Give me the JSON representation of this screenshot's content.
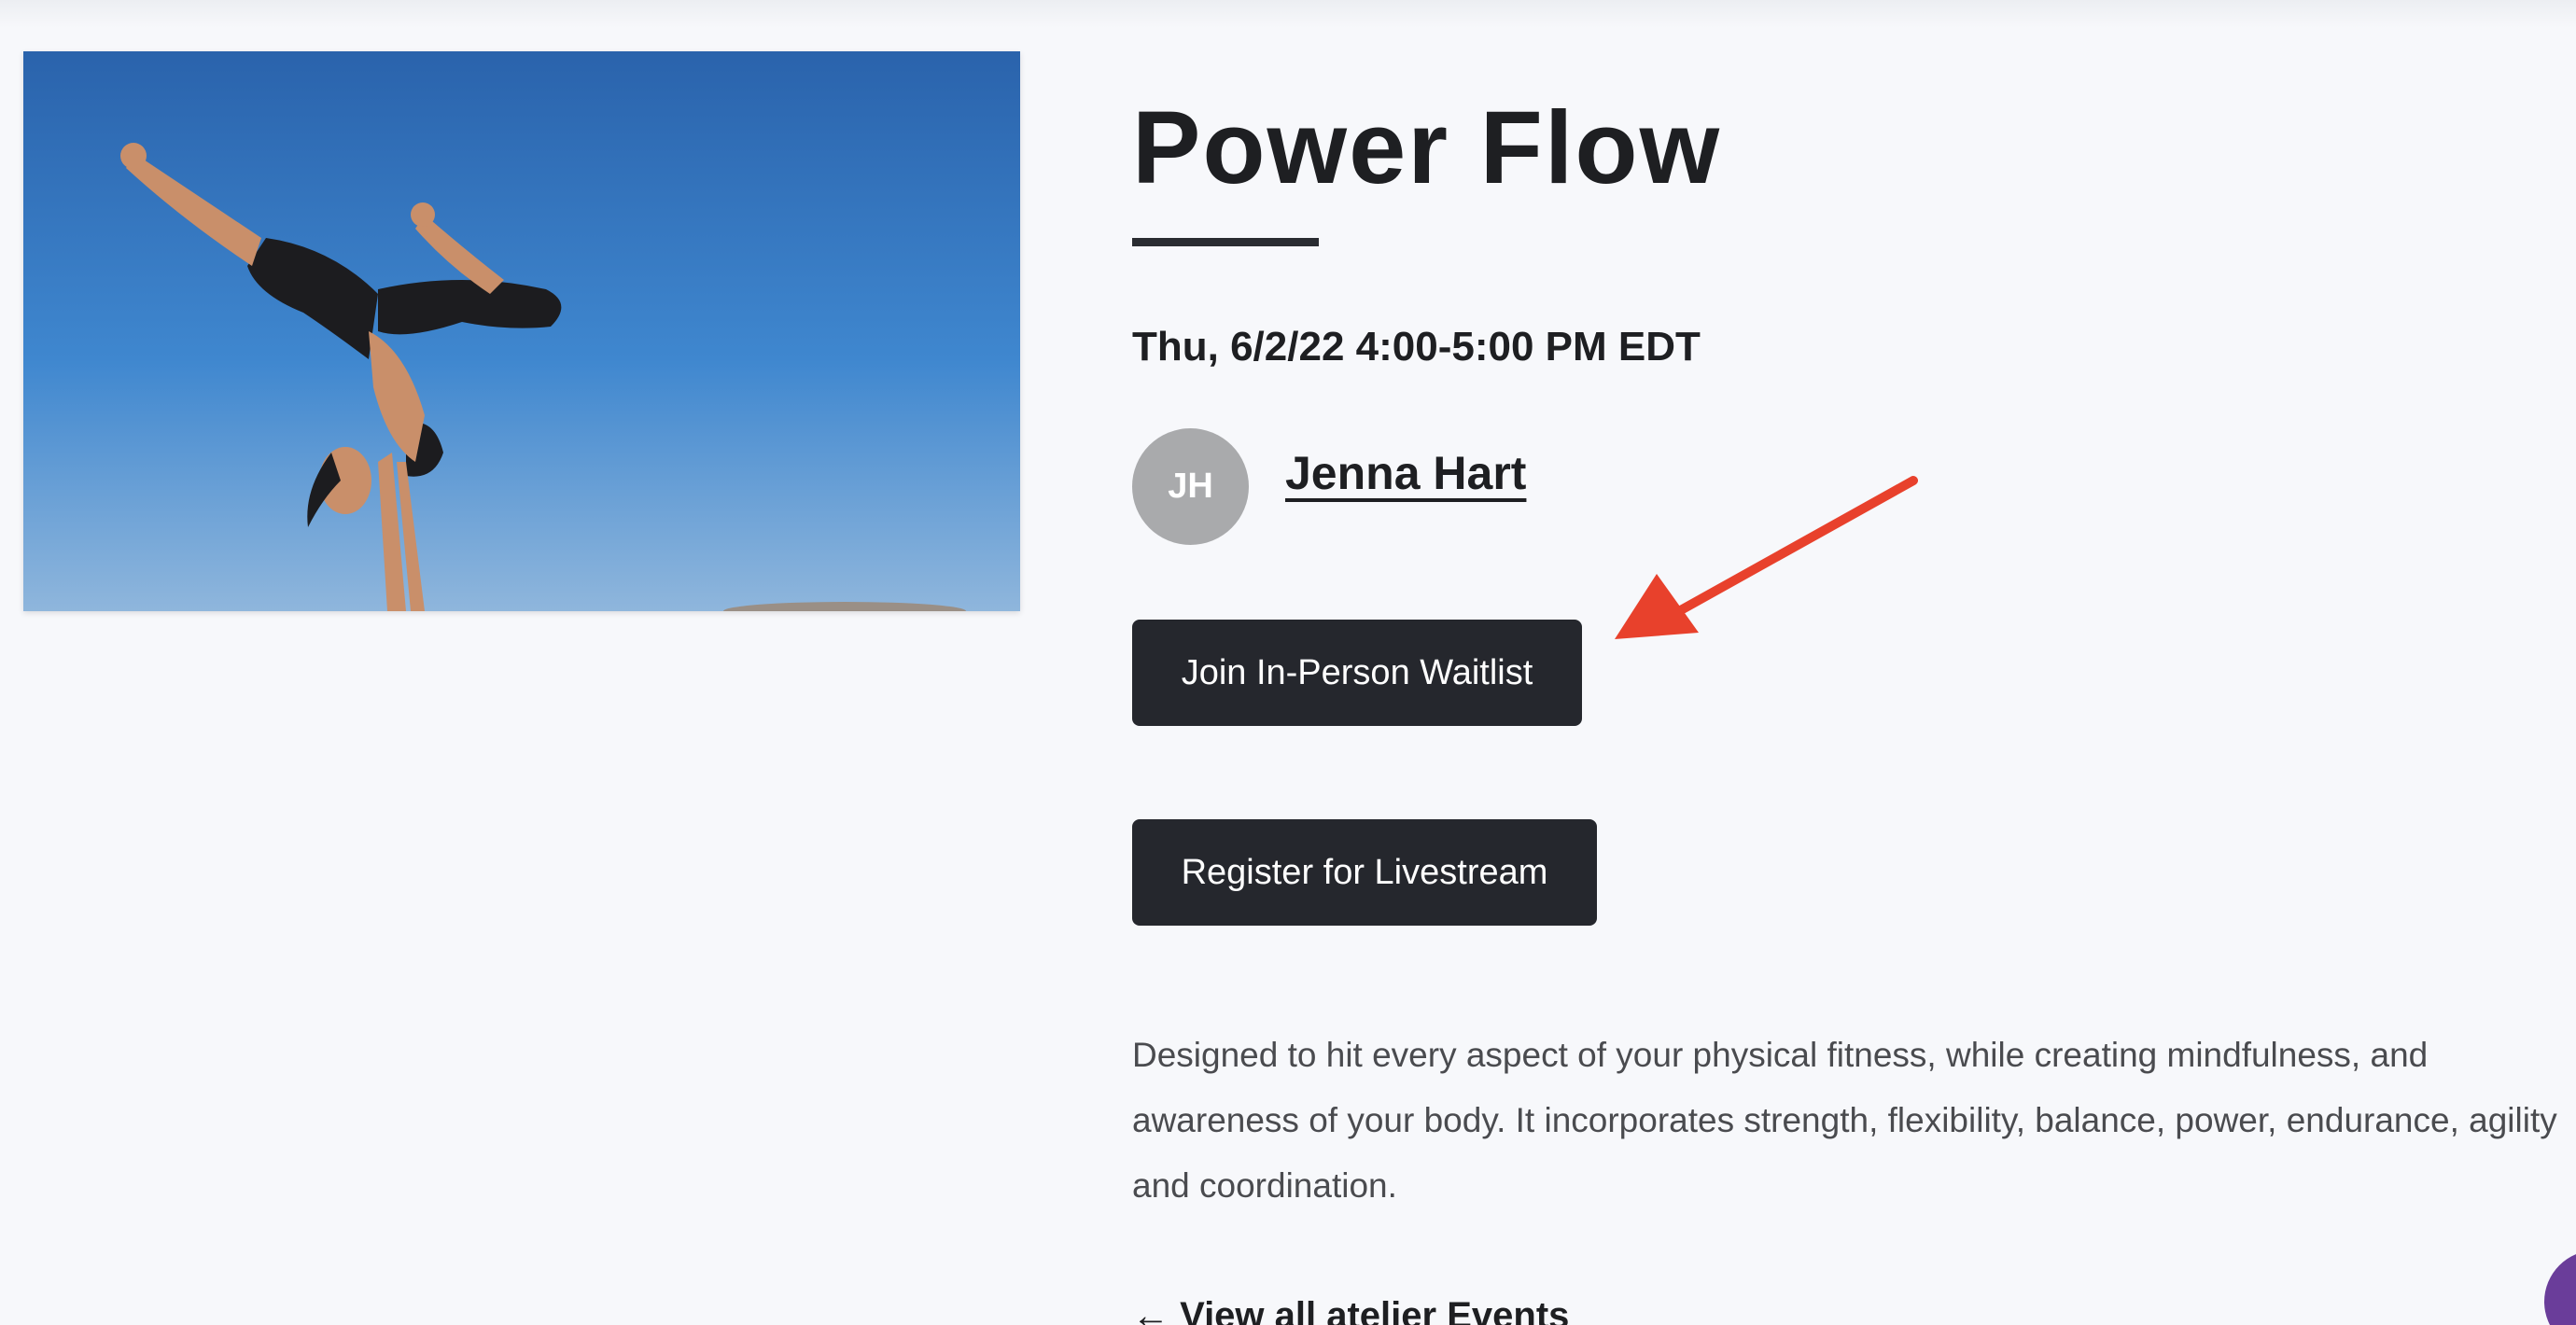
{
  "event": {
    "title": "Power Flow",
    "datetime": "Thu, 6/2/22 4:00-5:00 PM EDT",
    "instructor": {
      "initials": "JH",
      "name": "Jenna Hart"
    },
    "buttons": {
      "waitlist": "Join In-Person Waitlist",
      "livestream": "Register for Livestream"
    },
    "description": "Designed to hit every aspect of your physical fitness, while creating mindfulness, and awareness of your body. It incorporates strength, flexibility, balance, power, endurance, agility and coordination.",
    "back_link": "← View all atelier Events"
  },
  "annotation": {
    "arrow_color": "#e8412c",
    "arrow_target": "waitlist-button"
  },
  "icons": {
    "annotation": "arrow-icon",
    "chat": "chat-bubble-icon"
  },
  "colors": {
    "button_bg": "#25272d",
    "avatar_bg": "#a9aaac",
    "accent_chat": "#6a3d9a"
  }
}
